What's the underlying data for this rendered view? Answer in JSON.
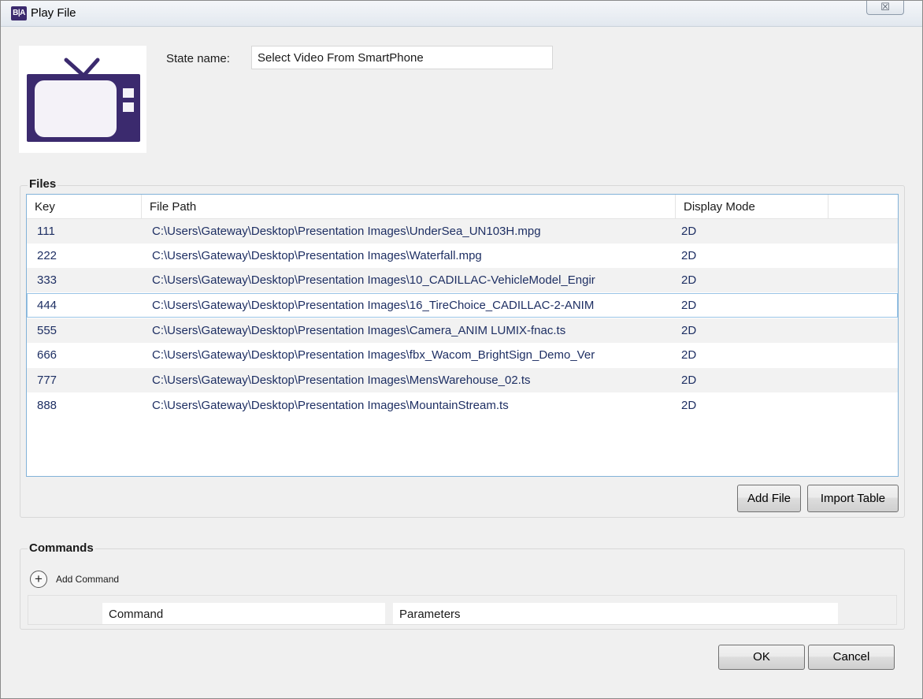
{
  "window": {
    "title": "Play File",
    "app_icon_text": "B|A",
    "close_symbol": "☒"
  },
  "state": {
    "label": "State name:",
    "value": "Select Video From SmartPhone"
  },
  "thumbnail": {
    "icon": "tv-icon",
    "color": "#3b2a6e"
  },
  "files": {
    "group_label": "Files",
    "columns": [
      "Key",
      "File Path",
      "Display Mode"
    ],
    "rows": [
      {
        "key": "111",
        "path": "C:\\Users\\Gateway\\Desktop\\Presentation Images\\UnderSea_UN103H.mpg",
        "mode": "2D"
      },
      {
        "key": "222",
        "path": "C:\\Users\\Gateway\\Desktop\\Presentation Images\\Waterfall.mpg",
        "mode": "2D"
      },
      {
        "key": "333",
        "path": "C:\\Users\\Gateway\\Desktop\\Presentation Images\\10_CADILLAC-VehicleModel_Engir",
        "mode": "2D"
      },
      {
        "key": "444",
        "path": "C:\\Users\\Gateway\\Desktop\\Presentation Images\\16_TireChoice_CADILLAC-2-ANIM",
        "mode": "2D"
      },
      {
        "key": "555",
        "path": "C:\\Users\\Gateway\\Desktop\\Presentation Images\\Camera_ANIM LUMIX-fnac.ts",
        "mode": "2D"
      },
      {
        "key": "666",
        "path": "C:\\Users\\Gateway\\Desktop\\Presentation Images\\fbx_Wacom_BrightSign_Demo_Ver",
        "mode": "2D"
      },
      {
        "key": "777",
        "path": "C:\\Users\\Gateway\\Desktop\\Presentation Images\\MensWarehouse_02.ts",
        "mode": "2D"
      },
      {
        "key": "888",
        "path": "C:\\Users\\Gateway\\Desktop\\Presentation Images\\MountainStream.ts",
        "mode": "2D"
      }
    ],
    "add_file_label": "Add File",
    "import_table_label": "Import Table"
  },
  "commands": {
    "group_label": "Commands",
    "add_command_label": "Add Command",
    "columns": [
      "Command",
      "Parameters"
    ]
  },
  "footer": {
    "ok_label": "OK",
    "cancel_label": "Cancel"
  }
}
